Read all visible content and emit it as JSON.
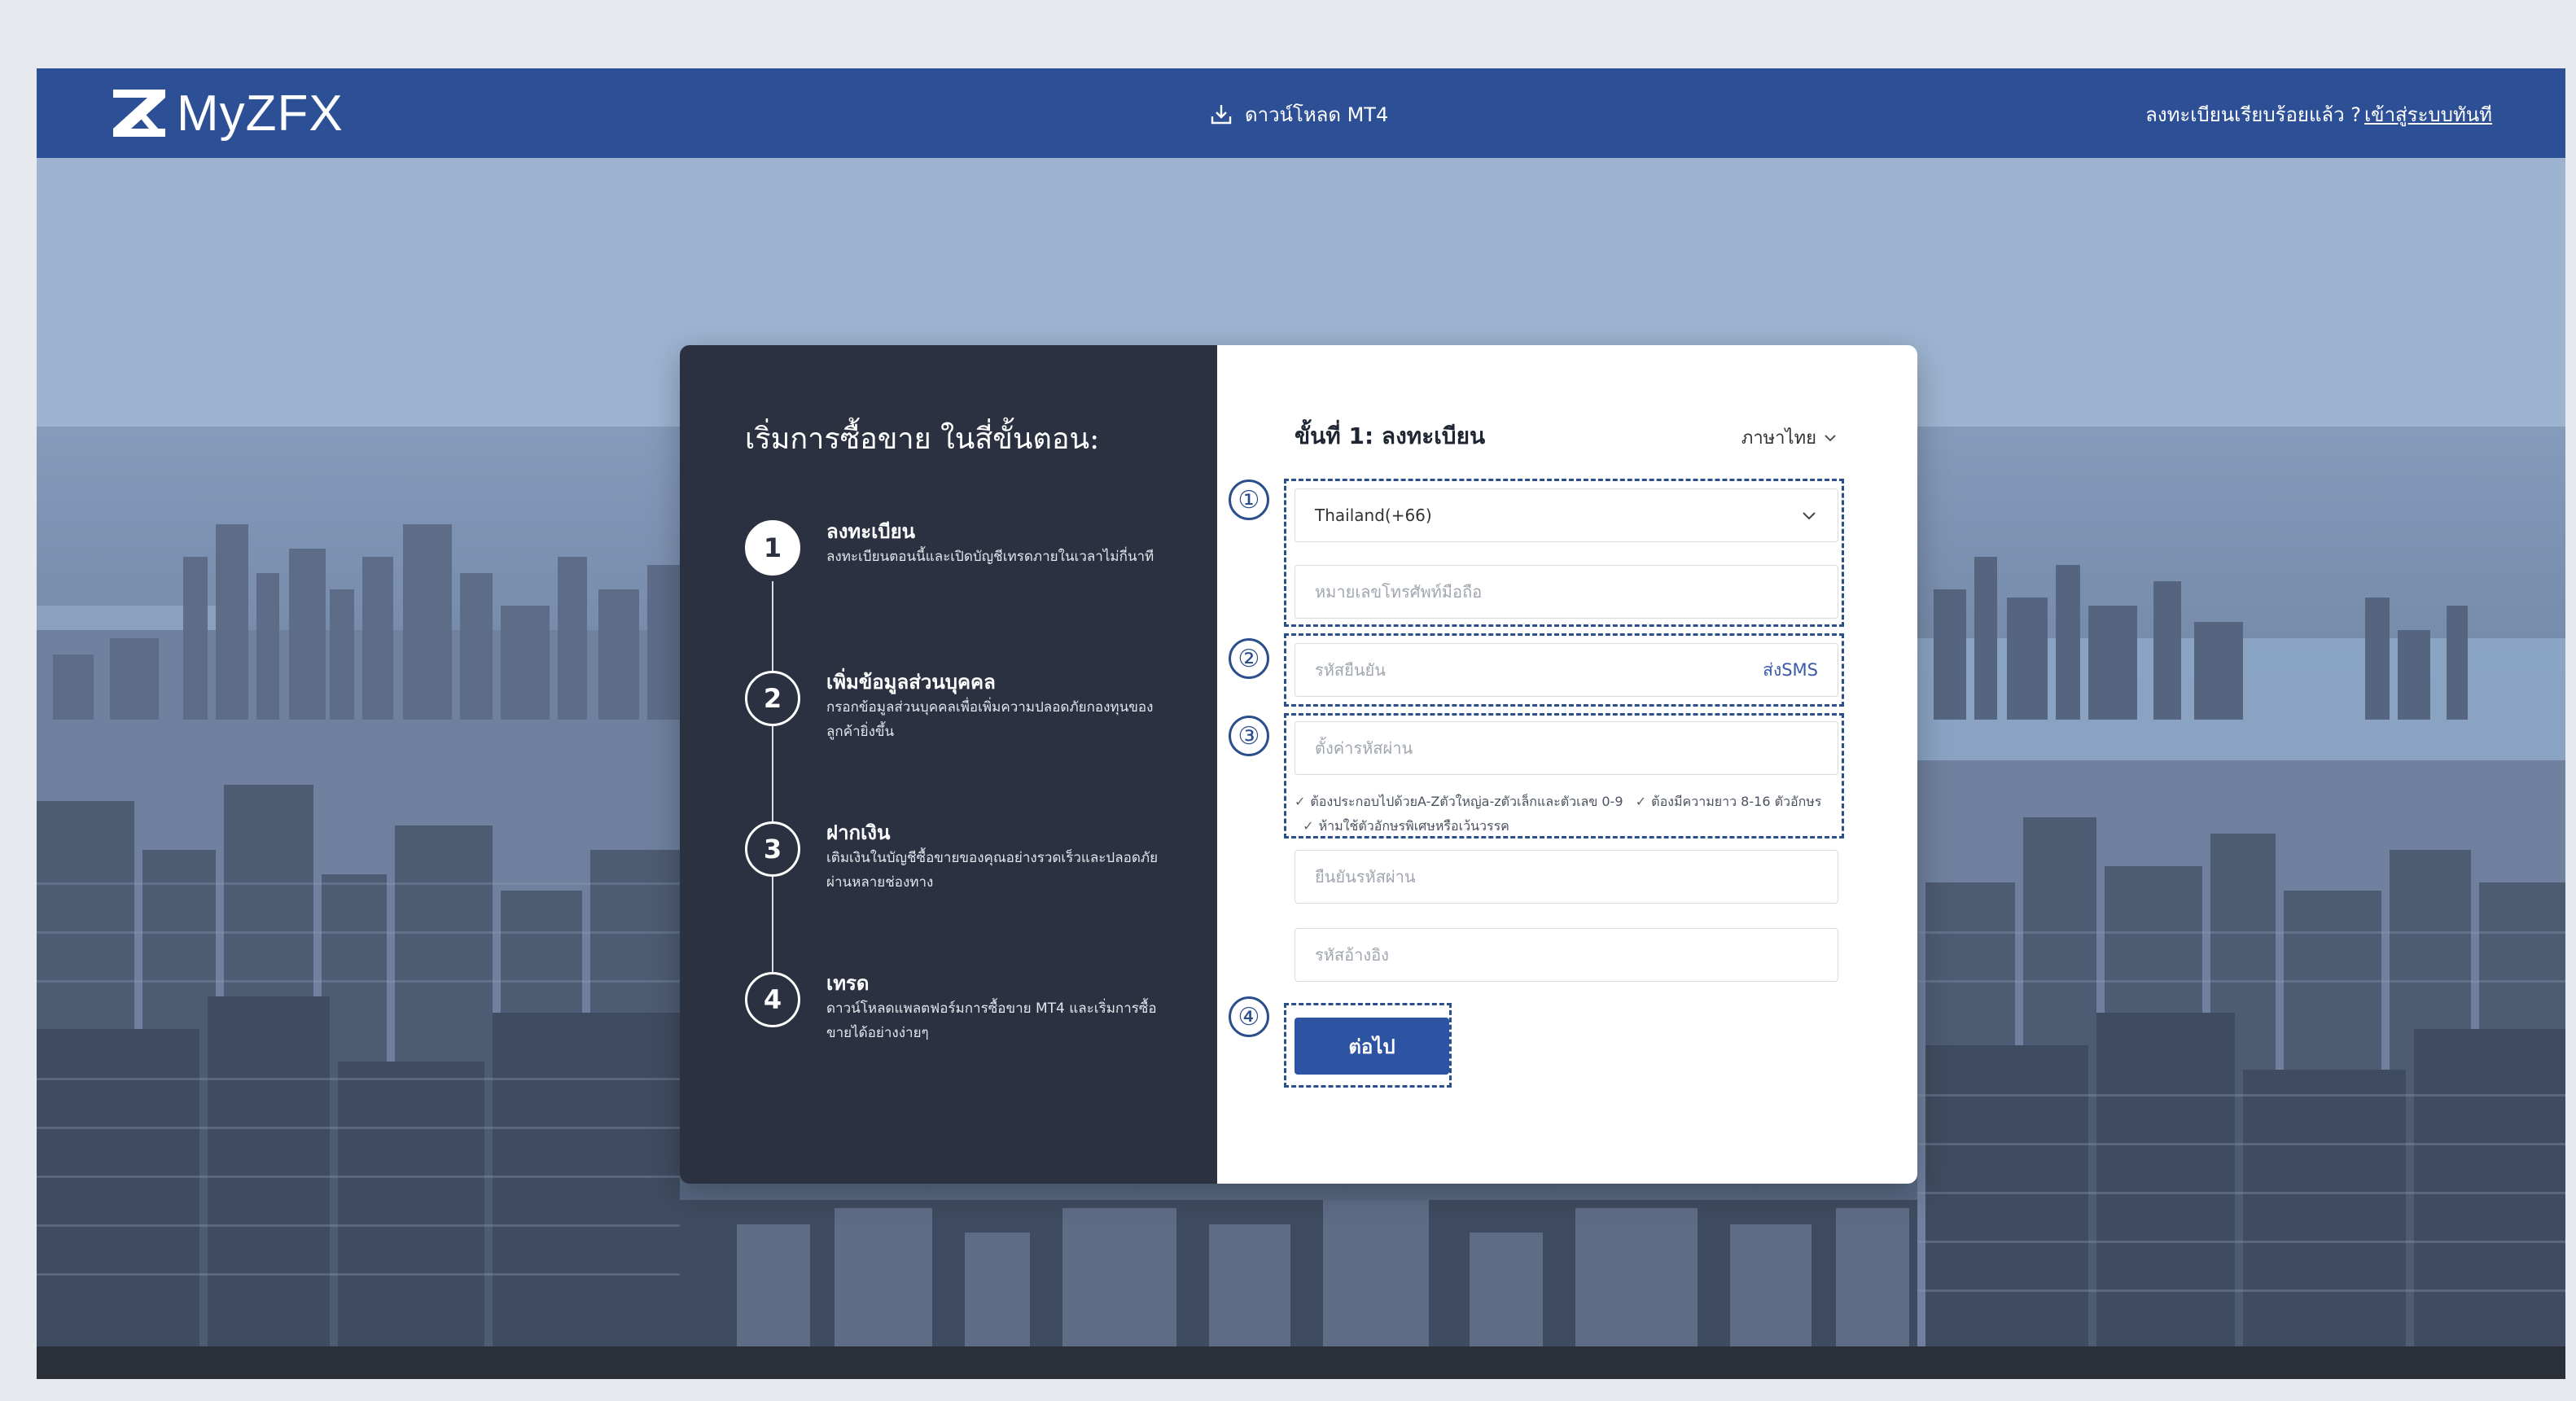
{
  "header": {
    "brand": "MyZFX",
    "download_label": "ดาวน์โหลด MT4",
    "login_prompt": "ลงทะเบียนเรียบร้อยแล้ว ?",
    "login_link": "เข้าสู่ระบบทันที"
  },
  "left_panel": {
    "title": "เริ่มการซื้อขาย ในสี่ขั้นตอน:",
    "steps": [
      {
        "number": "1",
        "title": "ลงทะเบียน",
        "desc": "ลงทะเบียนตอนนี้และเปิดบัญชีเทรดภายในเวลาไม่กี่นาที"
      },
      {
        "number": "2",
        "title": "เพิ่มข้อมูลส่วนบุคคล",
        "desc": "กรอกข้อมูลส่วนบุคคลเพื่อเพิ่มความปลอดภัยกองทุนของลูกค้ายิ่งขึ้น"
      },
      {
        "number": "3",
        "title": "ฝากเงิน",
        "desc": "เติมเงินในบัญชีซื้อขายของคุณอย่างรวดเร็วและปลอดภัยผ่านหลายช่องทาง"
      },
      {
        "number": "4",
        "title": "เทรด",
        "desc": "ดาวน์โหลดแพลตฟอร์มการซื้อขาย MT4 และเริ่มการซื้อขายได้อย่างง่ายๆ"
      }
    ]
  },
  "form": {
    "title": "ขั้นที่ 1: ลงทะเบียน",
    "language": "ภาษาไทย",
    "country_value": "Thailand(+66)",
    "phone_placeholder": "หมายเลขโทรศัพท์มือถือ",
    "code_placeholder": "รหัสยืนยัน",
    "send_sms": "ส่งSMS",
    "password_placeholder": "ตั้งค่ารหัสผ่าน",
    "hint_1": "ต้องประกอบไปด้วยA-Zตัวใหญ่a-zตัวเล็กและตัวเลข 0-9",
    "hint_2": "ต้องมีความยาว 8-16 ตัวอักษร",
    "hint_3": "ห้ามใช้ตัวอักษรพิเศษหรือเว้นวรรค",
    "confirm_placeholder": "ยืนยันรหัสผ่าน",
    "referral_placeholder": "รหัสอ้างอิง",
    "next_label": "ต่อไป"
  },
  "annotations": [
    "①",
    "②",
    "③",
    "④"
  ],
  "colors": {
    "header_bg": "#2c4f96",
    "left_panel_bg": "#2b3140",
    "button_bg": "#2c54a3",
    "annotation": "#2b4f8c"
  },
  "icons": {
    "download": "download-icon",
    "chevron": "chevron-down-icon",
    "check": "check-icon"
  }
}
